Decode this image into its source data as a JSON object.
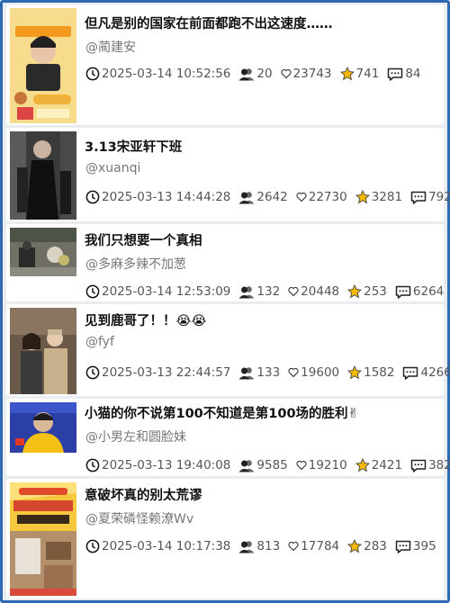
{
  "posts": [
    {
      "title": "但凡是别的国家在前面都跑不出这速度……",
      "author": "@蔺建安",
      "time": "2025-03-14 10:52:56",
      "users": "20",
      "likes": "23743",
      "stars": "741",
      "comments": "84",
      "thumb_text": [
        "冲冲冲冲冲",
        "赶紧吃饭吧"
      ]
    },
    {
      "title": "3.13宋亚轩下班",
      "author": "@xuanqi",
      "time": "2025-03-13 14:44:28",
      "users": "2642",
      "likes": "22730",
      "stars": "3281",
      "comments": "792",
      "thumb_text": []
    },
    {
      "title": "我们只想要一个真相",
      "author": "@多麻多辣不加葱",
      "time": "2025-03-14 12:53:09",
      "users": "132",
      "likes": "20448",
      "stars": "253",
      "comments": "6264",
      "thumb_text": []
    },
    {
      "title": "见到鹿哥了！！😭😭",
      "author": "@fyf",
      "time": "2025-03-13 22:44:57",
      "users": "133",
      "likes": "19600",
      "stars": "1582",
      "comments": "4266",
      "thumb_text": []
    },
    {
      "title": "小猫的你不说第100不知道是第100场的胜利✌",
      "author": "@小男左和圆脸妹",
      "time": "2025-03-13 19:40:08",
      "users": "9585",
      "likes": "19210",
      "stars": "2421",
      "comments": "382",
      "thumb_text": []
    },
    {
      "title": "意破坏真的别太荒谬",
      "author": "@夏荣磷怪赖潦Wv",
      "time": "2025-03-14 10:17:38",
      "users": "813",
      "likes": "17784",
      "stars": "283",
      "comments": "395",
      "thumb_text": [
        "学校装修工人",
        "砸坏家具被"
      ]
    }
  ],
  "colors": {
    "frame": "#2e6ab3",
    "star": "#f5b800",
    "card_bg": "#ffffff",
    "page_bg": "#e9ecf1"
  },
  "icons": [
    "clock-icon",
    "users-icon",
    "heart-icon",
    "star-icon",
    "comment-icon"
  ]
}
